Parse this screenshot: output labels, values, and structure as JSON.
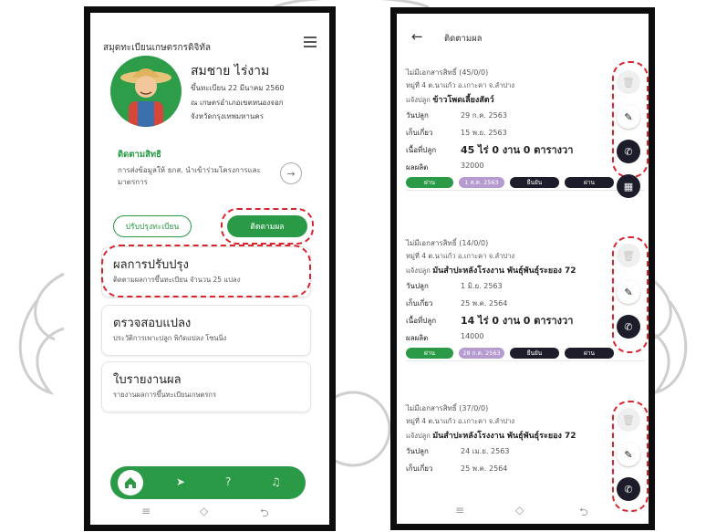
{
  "left_phone": {
    "header_title": "สมุดทะเบียนเกษตรกรดิจิทัล",
    "profile": {
      "name": "สมชาย  ไร่งาม",
      "registered": "ขึ้นทะเบียน 22 มีนาคม 2560",
      "office": "ณ เกษตรอำเภอเขตหนองจอก",
      "province": "จังหวัดกรุงเทพมหานคร"
    },
    "rights": {
      "title": "ติดตามสิทธิ",
      "description": "การส่งข้อมูลให้ ธกส. นำเข้าร่วมโครงการและมาตรการ"
    },
    "buttons": {
      "improve": "ปรับปรุงทะเบียน",
      "follow": "ติดตามผล"
    },
    "menu": [
      {
        "title": "ผลการปรับปรุง",
        "subtitle": "ติดตามผลการขึ้นทะเบียน จำนวน 25 แปลง"
      },
      {
        "title": "ตรวจสอบแปลง",
        "subtitle": "ประวัติการเพาะปลูก พิกัดแปลง โซนนิ่ง"
      },
      {
        "title": "ใบรายงานผล",
        "subtitle": "รายงานผลการขึ้นทะเบียนเกษตรกร"
      }
    ],
    "nav_icons": [
      "home-icon",
      "send-icon",
      "help-icon",
      "bell-icon"
    ]
  },
  "right_phone": {
    "title": "ติดตามผล",
    "labels": {
      "plant_date": "วันปลูก",
      "harvest_date": "เก็บเกี่ยว",
      "area": "เนื้อที่ปลูก",
      "yield": "ผลผลิต"
    },
    "records": [
      {
        "doc": "ไม่มีเอกสารสิทธิ์ (45/0/0)",
        "address": "หมู่ที่ 4 ต.นาแก้ว อ.เกาะคา จ.ลำปาง",
        "crop_prefix": "แจ้งปลูก",
        "crop": "ข้าวโพดเลี้ยงสัตว์",
        "plant_date": "29 ก.ค. 2563",
        "harvest_date": "15 พ.ย. 2563",
        "area": "45 ไร่ 0 งาน 0 ตารางวา",
        "yield": "32000",
        "tags": [
          "ผ่าน",
          "1 ส.ค. 2563",
          "ยืนยัน",
          "ผ่าน"
        ]
      },
      {
        "doc": "ไม่มีเอกสารสิทธิ์ (14/0/0)",
        "address": "หมู่ที่ 4 ต.นาแก้ว อ.เกาะคา จ.ลำปาง",
        "crop_prefix": "แจ้งปลูก",
        "crop": "มันสำปะหลังโรงงาน พันธุ์พันธุ์ระยอง 72",
        "plant_date": "1 มิ.ย. 2563",
        "harvest_date": "25 พ.ค. 2564",
        "area": "14 ไร่ 0 งาน 0 ตารางวา",
        "yield": "14000",
        "tags": [
          "ผ่าน",
          "28 ก.ค. 2563",
          "ยืนยัน",
          "ผ่าน"
        ]
      },
      {
        "doc": "ไม่มีเอกสารสิทธิ์ (37/0/0)",
        "address": "หมู่ที่ 4 ต.นาแก้ว อ.เกาะคา จ.ลำปาง",
        "crop_prefix": "แจ้งปลูก",
        "crop": "มันสำปะหลังโรงงาน พันธุ์พันธุ์ระยอง 72",
        "plant_date": "24 เม.ย. 2563",
        "harvest_date": "25 พ.ค. 2564"
      }
    ]
  },
  "colors": {
    "brand_green": "#2b9a47",
    "highlight_red": "#d6262f",
    "fab_dark": "#1c1c2a",
    "tag_purple": "#b59bd0"
  }
}
